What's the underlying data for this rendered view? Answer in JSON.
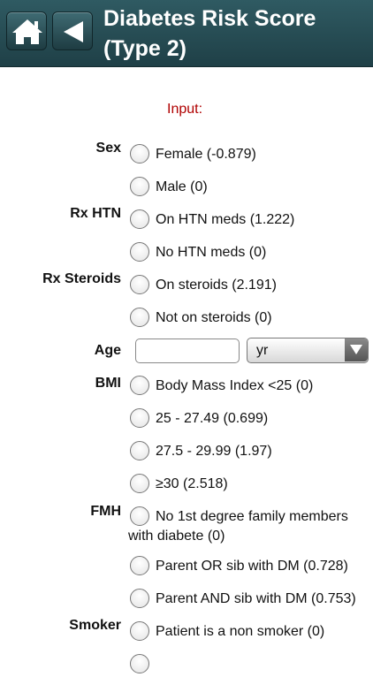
{
  "header": {
    "title": "Diabetes Risk Score (Type 2)",
    "home_icon": "home-icon",
    "back_icon": "back-arrow-icon",
    "accent": "#24484f"
  },
  "input_label": "Input:",
  "sections": {
    "sex": {
      "label": "Sex",
      "options": [
        "Female (-0.879)",
        "Male (0)"
      ]
    },
    "rx_htn": {
      "label": "Rx HTN",
      "options": [
        "On HTN meds (1.222)",
        "No HTN meds (0)"
      ]
    },
    "rx_steroids": {
      "label": "Rx Steroids",
      "options": [
        "On steroids (2.191)",
        "Not on steroids (0)"
      ]
    },
    "age": {
      "label": "Age",
      "value": "",
      "unit": "yr"
    },
    "bmi": {
      "label": "BMI",
      "options": [
        "Body Mass Index <25 (0)",
        "25 - 27.49 (0.699)",
        "27.5 - 29.99 (1.97)",
        "≥30 (2.518)"
      ]
    },
    "fmh": {
      "label": "FMH",
      "options": [
        "No 1st degree family members",
        "with diabete (0)",
        "Parent OR sib with DM (0.728)",
        "Parent AND sib with DM (0.753)"
      ]
    },
    "smoker": {
      "label": "Smoker",
      "options": [
        "Patient is a non smoker (0)"
      ]
    }
  }
}
